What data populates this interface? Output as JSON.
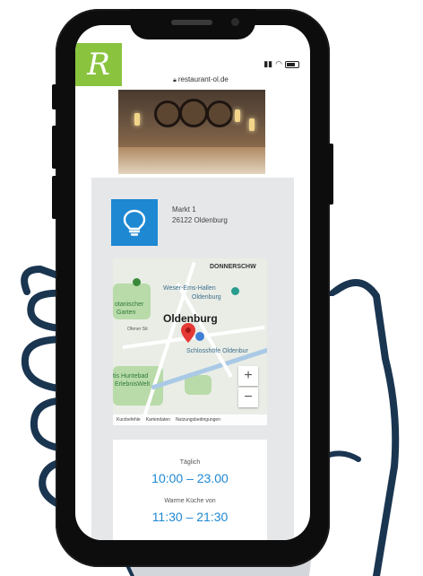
{
  "browser": {
    "url": "restaurant-ol.de"
  },
  "brand": {
    "logo_letter": "R",
    "logo_color": "#8ac43f"
  },
  "contact": {
    "icon": "lightbulb-icon",
    "icon_color": "#1e88d3",
    "street": "Markt 1",
    "city": "26122 Oldenburg"
  },
  "map": {
    "city": "Oldenburg",
    "labels": {
      "donnerschwee": "DONNERSCHW",
      "weser_ems": "Weser-Ems-Hallen",
      "weser_ems_city": "Oldenburg",
      "botanischer": "otanischer",
      "botanischer2": "Garten",
      "schloss": "Schlosshöfe Oldenbur",
      "huntebad": "tis Huntebad",
      "erlebnis": "ErlebnisWelt",
      "ofener": "Ofener Str"
    },
    "zoom_in": "+",
    "zoom_out": "−",
    "footer": {
      "shortcuts": "Kurzbefehle",
      "mapdata": "Kartendaten",
      "terms": "Nutzungsbedingungen"
    }
  },
  "hours": {
    "daily_label": "Täglich",
    "daily_value": "10:00 – 23.00",
    "kitchen_label": "Warme Küche von",
    "kitchen_value": "11:30 – 21:30"
  }
}
